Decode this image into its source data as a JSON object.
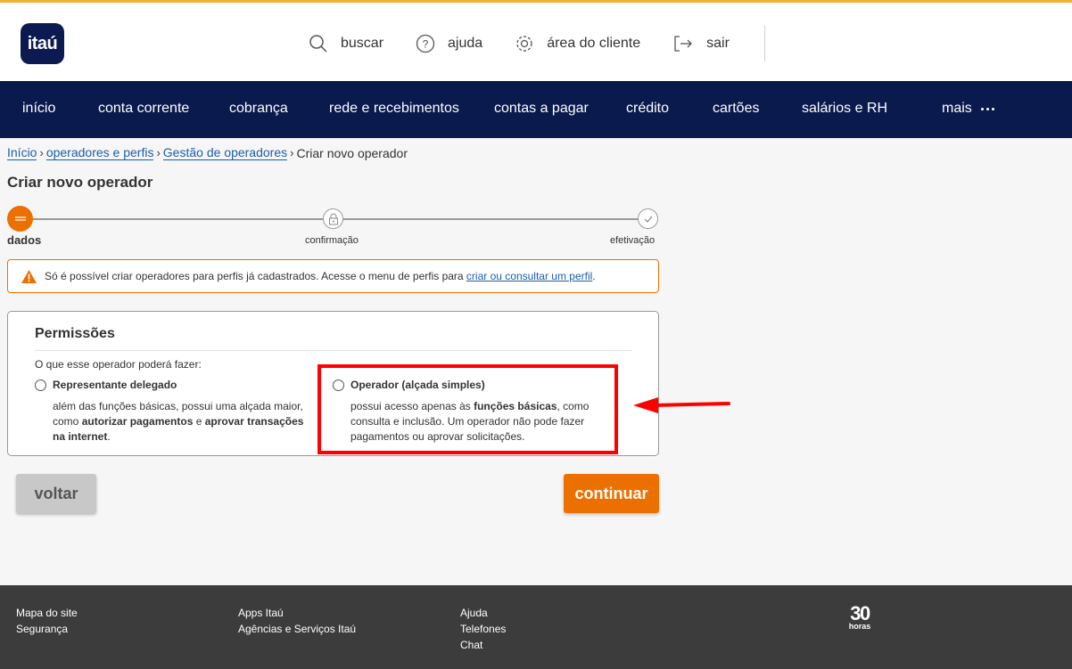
{
  "header": {
    "logo_text": "itaú",
    "links": [
      {
        "label": "buscar",
        "icon": "search-icon"
      },
      {
        "label": "ajuda",
        "icon": "help-icon"
      },
      {
        "label": "área do cliente",
        "icon": "gear-icon"
      },
      {
        "label": "sair",
        "icon": "logout-icon"
      }
    ]
  },
  "nav": {
    "items": [
      "início",
      "conta corrente",
      "cobrança",
      "rede e recebimentos",
      "contas a pagar",
      "crédito",
      "cartões",
      "salários e RH"
    ],
    "more_label": "mais"
  },
  "breadcrumb": {
    "items": [
      "Início",
      "operadores e perfis",
      "Gestão de operadores"
    ],
    "current": "Criar novo operador"
  },
  "page": {
    "title": "Criar novo operador"
  },
  "stepper": {
    "steps": [
      "dados",
      "confirmação",
      "efetivação"
    ]
  },
  "alert": {
    "text": "Só é possível criar operadores para perfis já cadastrados. Acesse o menu de perfis para ",
    "link": "criar ou consultar um perfil",
    "end": "."
  },
  "permissions": {
    "title": "Permissões",
    "question": "O que esse operador poderá fazer:",
    "options": [
      {
        "title": "Representante delegado",
        "desc_a": "além das funções básicas, possui uma alçada maior, como ",
        "desc_b": "autorizar pagamentos",
        "desc_c": " e ",
        "desc_d": "aprovar transações na internet",
        "desc_e": "."
      },
      {
        "title": "Operador (alçada simples)",
        "desc_a": "possui acesso apenas às ",
        "desc_b": "funções básicas",
        "desc_c": ", como consulta e inclusão. Um operador não pode fazer pagamentos ou aprovar solicitações."
      }
    ]
  },
  "buttons": {
    "back": "voltar",
    "continue": "continuar"
  },
  "footer": {
    "col1": [
      "Mapa do site",
      "Segurança"
    ],
    "col2": [
      "Apps Itaú",
      "Agências e Serviços Itaú"
    ],
    "col3": [
      "Ajuda",
      "Telefones",
      "Chat"
    ],
    "badge_number": "30",
    "badge_text": "horas"
  },
  "colors": {
    "brand_orange": "#ec7000",
    "brand_navy": "#0a1a4d",
    "annotation_red": "#ff0000"
  }
}
